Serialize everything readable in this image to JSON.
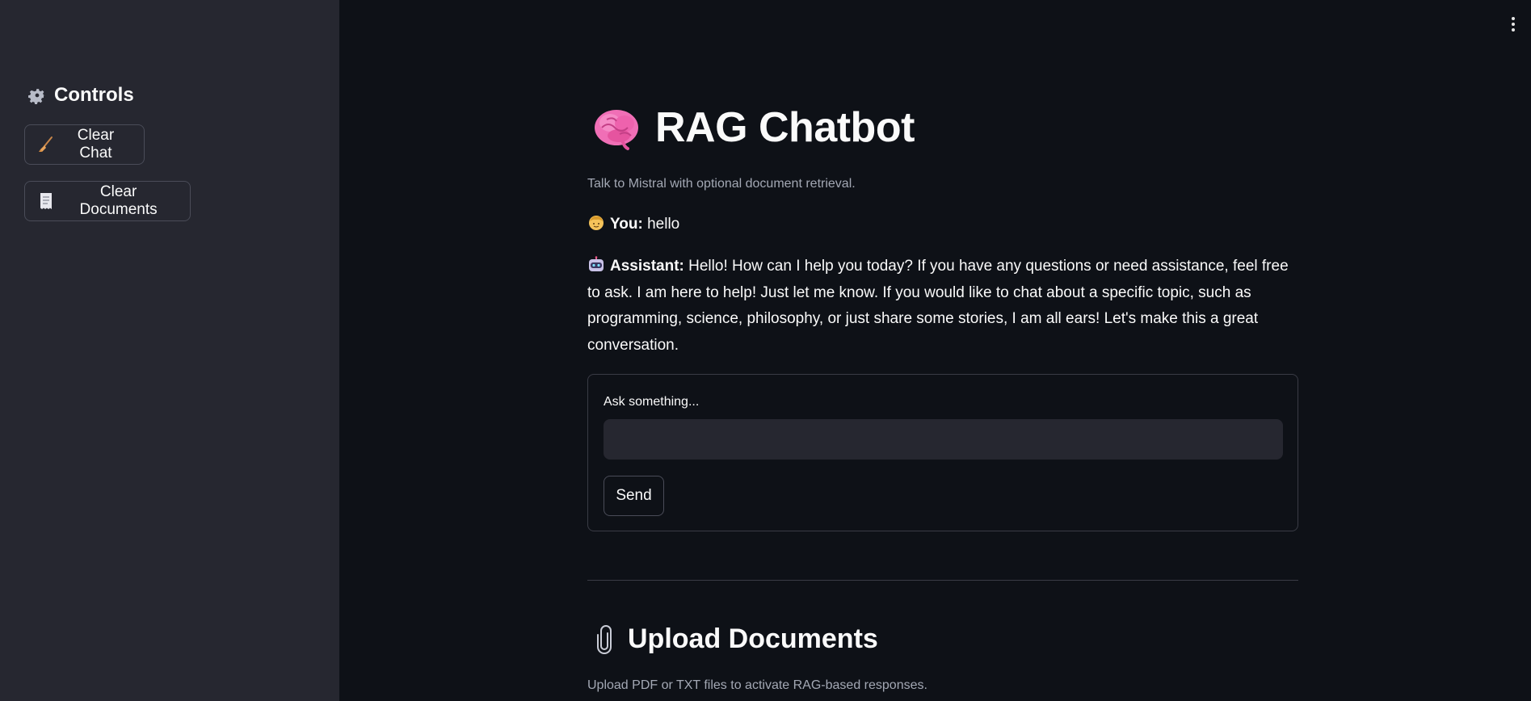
{
  "sidebar": {
    "header_icon": "gear-icon",
    "header": "Controls",
    "buttons": [
      {
        "icon": "broom-icon",
        "label": "Clear Chat"
      },
      {
        "icon": "receipt-icon",
        "label": "Clear Documents"
      }
    ]
  },
  "main": {
    "title_icon": "brain-icon",
    "title": "RAG Chatbot",
    "subtitle": "Talk to Mistral with optional document retrieval.",
    "messages": [
      {
        "role_icon": "person-icon",
        "role": "You:",
        "text": "hello"
      },
      {
        "role_icon": "robot-icon",
        "role": "Assistant:",
        "text": "Hello! How can I help you today? If you have any questions or need assistance, feel free to ask. I am here to help! Just let me know. If you would like to chat about a specific topic, such as programming, science, philosophy, or just share some stories, I am all ears! Let's make this a great conversation."
      }
    ],
    "form": {
      "label": "Ask something...",
      "input_value": "",
      "send_label": "Send"
    },
    "upload": {
      "icon": "paperclip-icon",
      "title": "Upload Documents",
      "subtitle": "Upload PDF or TXT files to activate RAG-based responses."
    }
  },
  "colors": {
    "background": "#0e1117",
    "sidebar": "#262730",
    "text": "#fafafa",
    "muted": "#a3a8b4",
    "border": "#3a3c46"
  }
}
